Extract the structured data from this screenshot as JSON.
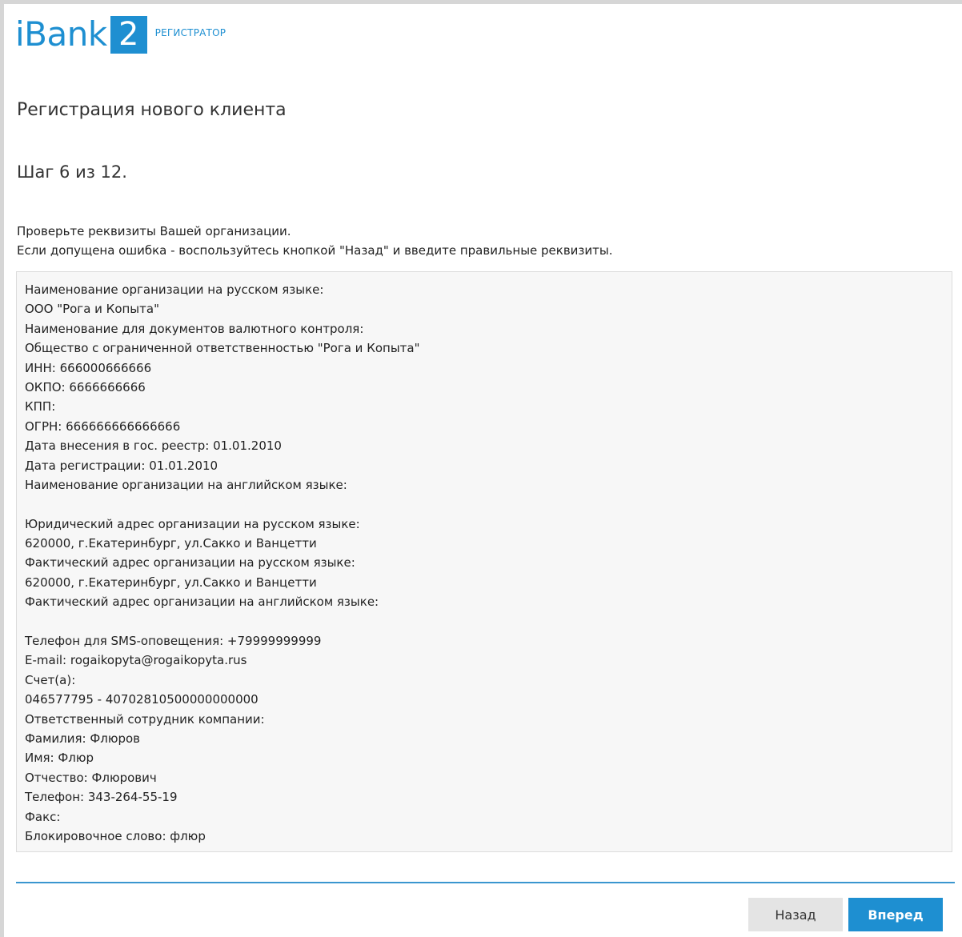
{
  "header": {
    "logo_word": "iBank",
    "logo_number": "2",
    "logo_subtitle": "РЕГИСТРАТОР",
    "brand_color": "#1e8fd1"
  },
  "page_title": "Регистрация нового клиента",
  "step_title": "Шаг 6 из 12.",
  "instructions": [
    "Проверьте реквизиты Вашей организации.",
    "Если допущена ошибка - воспользуйтесь кнопкой \"Назад\" и введите правильные реквизиты."
  ],
  "details_lines": [
    "Наименование организации на русском языке:",
    "ООО \"Рога и Копыта\"",
    "Наименование для документов валютного контроля:",
    "Общество с ограниченной ответственностью \"Рога и Копыта\"",
    "ИНН: 666000666666",
    "ОКПО: 6666666666",
    "КПП:",
    "ОГРН: 666666666666666",
    "Дата внесения в гос. реестр: 01.01.2010",
    "Дата регистрации: 01.01.2010",
    "Наименование организации на английском языке:",
    "",
    "Юридический адрес организации на русском языке:",
    "620000, г.Екатеринбург, ул.Сакко и Ванцетти",
    "Фактический адрес организации на русском языке:",
    "620000, г.Екатеринбург, ул.Сакко и Ванцетти",
    "Фактический адрес организации на английском языке:",
    "",
    "Телефон для SMS-оповещения: +79999999999",
    "E-mail: rogaikopyta@rogaikopyta.rus",
    "Счет(а):",
    "046577795 - 40702810500000000000",
    "Ответственный сотрудник компании:",
    "Фамилия: Флюров",
    "Имя: Флюр",
    "Отчество: Флюрович",
    "Телефон: 343-264-55-19",
    "Факс:",
    "Блокировочное слово: флюр"
  ],
  "buttons": {
    "back_label": "Назад",
    "next_label": "Вперед"
  }
}
